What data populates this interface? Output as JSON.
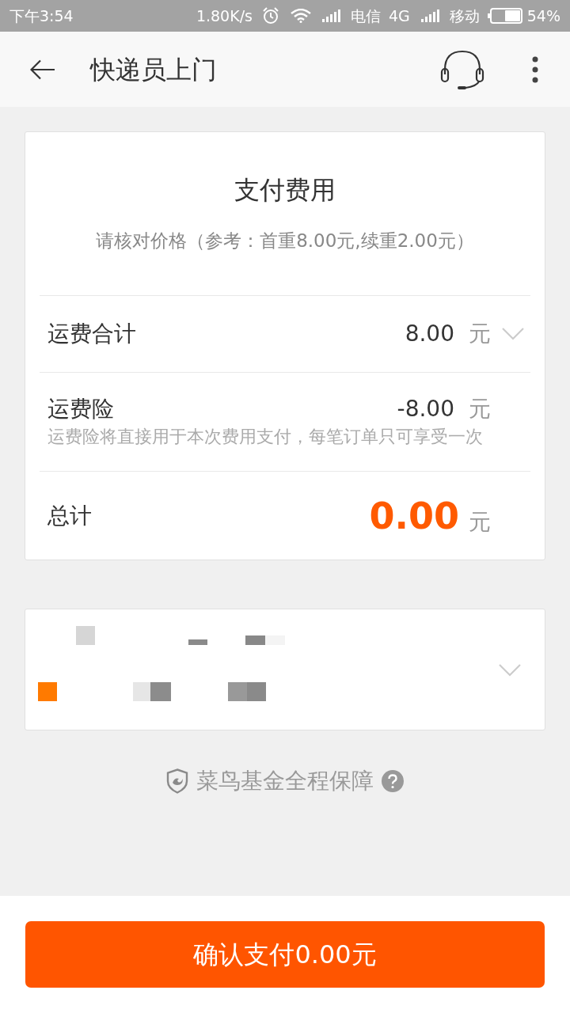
{
  "status_bar": {
    "time": "下午3:54",
    "speed": "1.80K/s",
    "sims": [
      {
        "carrier": "电信",
        "network": "4G"
      },
      {
        "carrier": "移动"
      }
    ],
    "battery": "54%"
  },
  "header": {
    "title": "快递员上门"
  },
  "payment_card": {
    "title": "支付费用",
    "subtitle": "请核对价格（参考：首重8.00元,续重2.00元）",
    "rows": [
      {
        "kind": "expandable",
        "label": "运费合计",
        "amount": "8.00",
        "unit": "元"
      },
      {
        "kind": "note",
        "label": "运费险",
        "amount": "-8.00",
        "unit": "元",
        "note": "运费险将直接用于本次费用支付，每笔订单只可享受一次"
      },
      {
        "kind": "total",
        "label": "总计",
        "amount": "0.00",
        "unit": "元"
      }
    ]
  },
  "guarantee": {
    "text": "菜鸟基金全程保障"
  },
  "confirm_button": {
    "label": "确认支付0.00元"
  }
}
